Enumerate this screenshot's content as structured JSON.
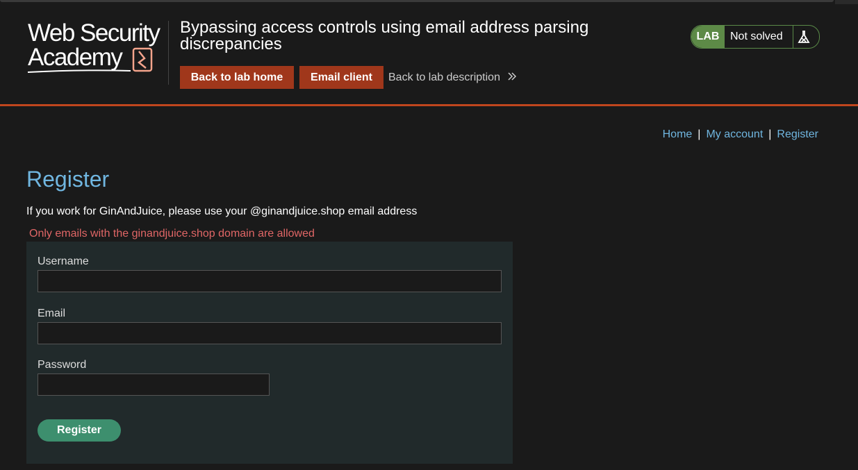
{
  "header": {
    "logo_line1": "Web Security",
    "logo_line2": "Academy",
    "lab_title": "Bypassing access controls using email address parsing discrepancies",
    "back_to_lab_home": "Back to lab home",
    "email_client": "Email client",
    "back_to_lab_description": "Back to lab description",
    "lab_badge": "LAB",
    "lab_status": "Not solved"
  },
  "nav": {
    "home": "Home",
    "separator": "|",
    "my_account": "My account",
    "register": "Register"
  },
  "main": {
    "title": "Register",
    "intro": "If you work for GinAndJuice, please use your @ginandjuice.shop email address",
    "error": "Only emails with the ginandjuice.shop domain are allowed",
    "form": {
      "username_label": "Username",
      "username_value": "",
      "email_label": "Email",
      "email_value": "",
      "password_label": "Password",
      "password_value": "",
      "submit_label": "Register"
    }
  },
  "colors": {
    "accent_orange": "#a0371b",
    "header_line": "#c0461d",
    "link_blue": "#70b6e0",
    "lab_green": "#5d8a47",
    "error_red": "#e06666",
    "register_button": "#3d8f6e",
    "form_bg": "#212a2b"
  }
}
